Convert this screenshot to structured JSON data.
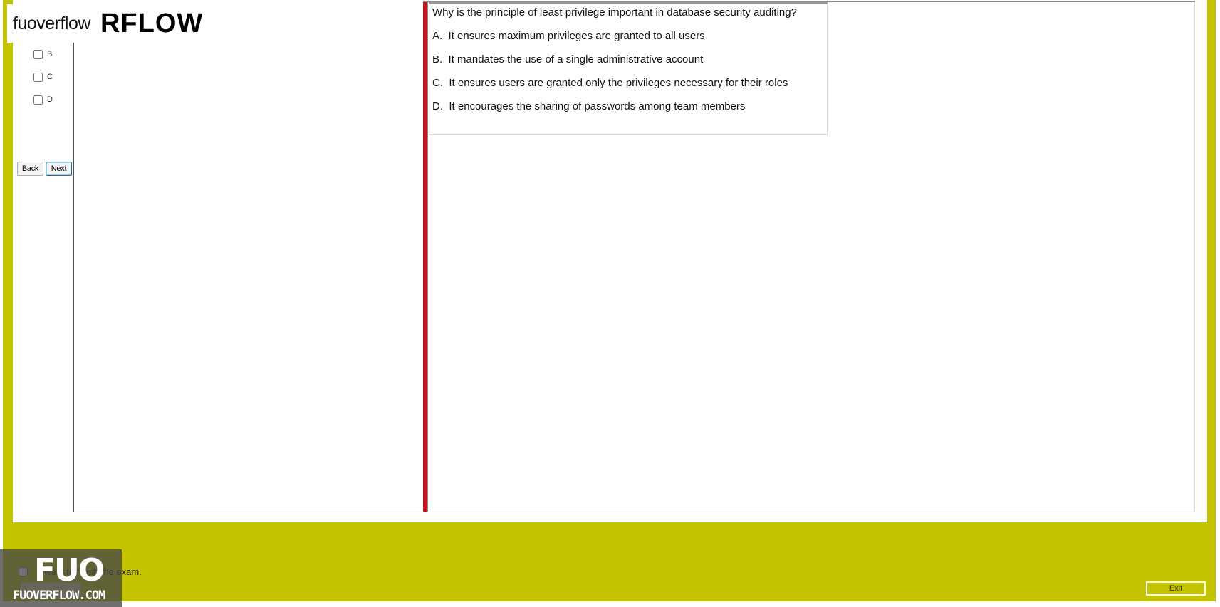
{
  "logo": {
    "light_text": "fuoverflow",
    "bold_text": "RFLOW"
  },
  "sidebar": {
    "options": [
      {
        "label": "B",
        "checked": false
      },
      {
        "label": "C",
        "checked": false
      },
      {
        "label": "D",
        "checked": false
      }
    ],
    "back_label": "Back",
    "next_label": "Next"
  },
  "question": {
    "text": "Why is the principle of least privilege important in database security auditing?",
    "answers": [
      {
        "letter": "A.",
        "text": "It ensures maximum privileges are granted to all users"
      },
      {
        "letter": "B.",
        "text": "It mandates the use of a single administrative account"
      },
      {
        "letter": "C.",
        "text": "It ensures users are granted only the privileges necessary for their roles"
      },
      {
        "letter": "D.",
        "text": "It encourages the sharing of passwords among team members"
      }
    ]
  },
  "footer": {
    "finish_label": "I want to finish the exam.",
    "finish_checked": false,
    "exit_label": "Exit"
  },
  "watermark": {
    "big_text": "FUO",
    "small_text": "FUOVERFLOW.COM"
  },
  "colors": {
    "frame": "#c3c300",
    "splitter": "#c5161d"
  }
}
